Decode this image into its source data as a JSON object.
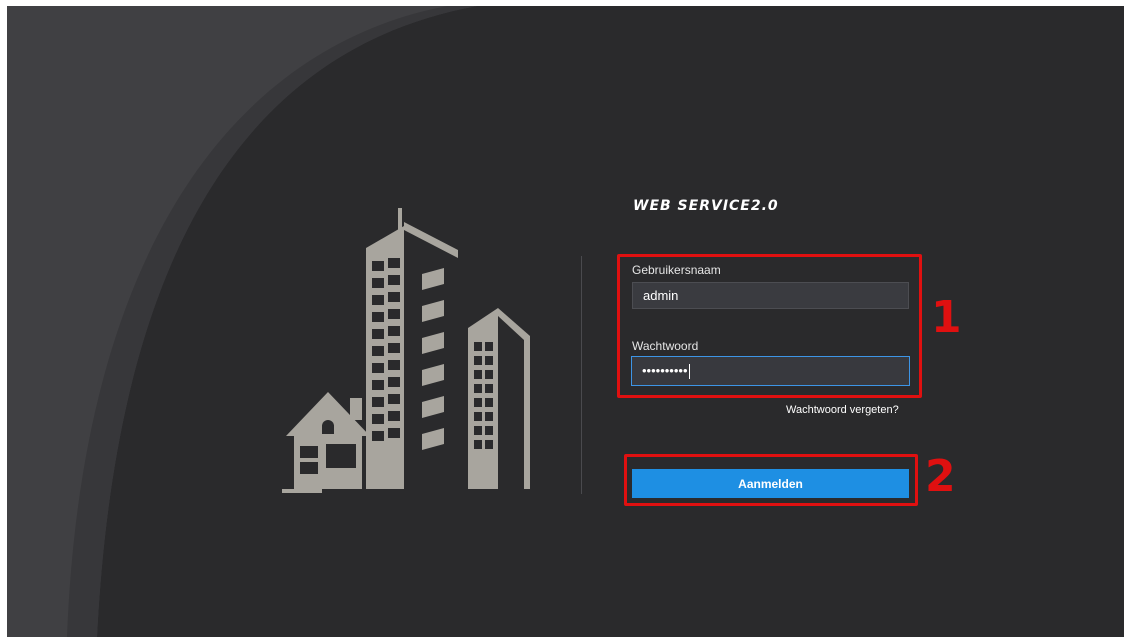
{
  "app": {
    "title": "WEB SERVICE2.0"
  },
  "login": {
    "username_label": "Gebruikersnaam",
    "username_value": "admin",
    "password_label": "Wachtwoord",
    "password_value": "••••••••••",
    "forgot_label": "Wachtwoord vergeten?",
    "submit_label": "Aanmelden"
  },
  "annotations": {
    "step1": "1",
    "step2": "2"
  },
  "colors": {
    "background": "#2a2a2c",
    "accent": "#1e8fe3",
    "building": "#a8a59e",
    "annotation": "#e01010"
  },
  "icons": {
    "illustration": "city-buildings-illustration"
  }
}
